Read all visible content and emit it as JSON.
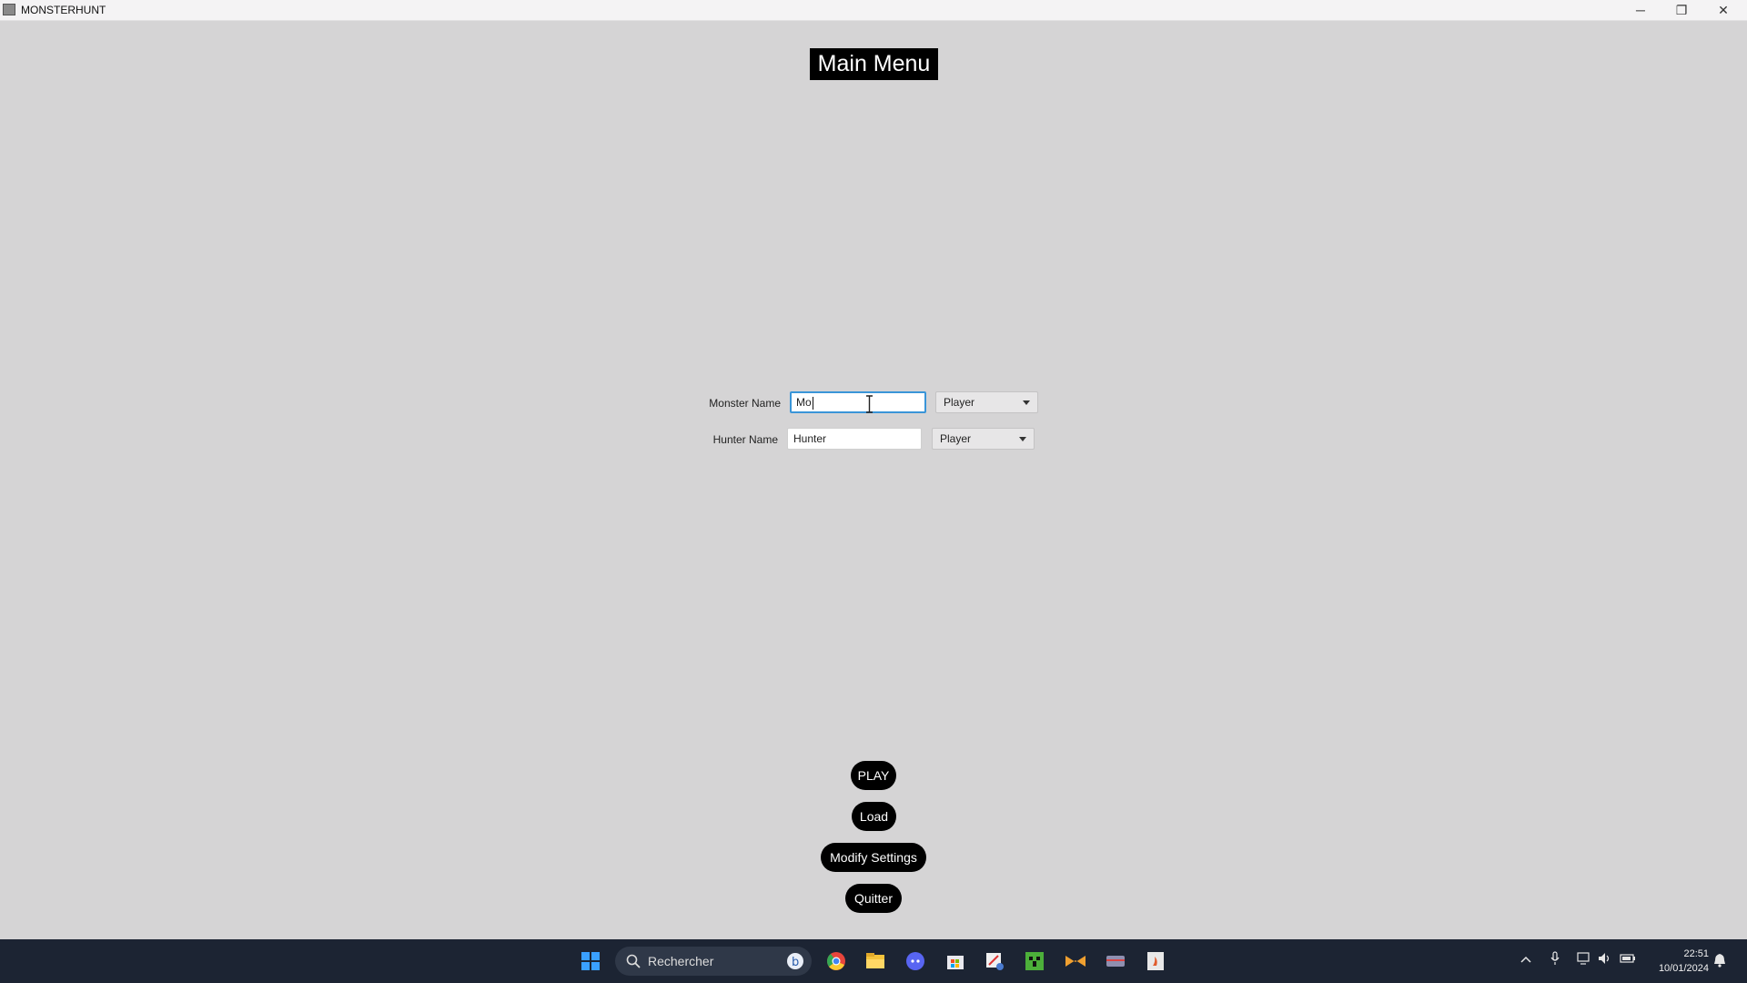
{
  "window": {
    "title": "MONSTERHUNT",
    "minimize": "─",
    "maximize": "❐",
    "close": "✕"
  },
  "menu": {
    "title": "Main Menu"
  },
  "form": {
    "monster": {
      "label": "Monster Name",
      "value": "Mo",
      "type": "Player"
    },
    "hunter": {
      "label": "Hunter Name",
      "value": "Hunter",
      "type": "Player"
    }
  },
  "buttons": {
    "play": "PLAY",
    "load": "Load",
    "settings": "Modify Settings",
    "quit": "Quitter"
  },
  "taskbar": {
    "search_placeholder": "Rechercher",
    "clock_time": "22:51",
    "clock_date": "10/01/2024",
    "accent": "#1c2433"
  }
}
